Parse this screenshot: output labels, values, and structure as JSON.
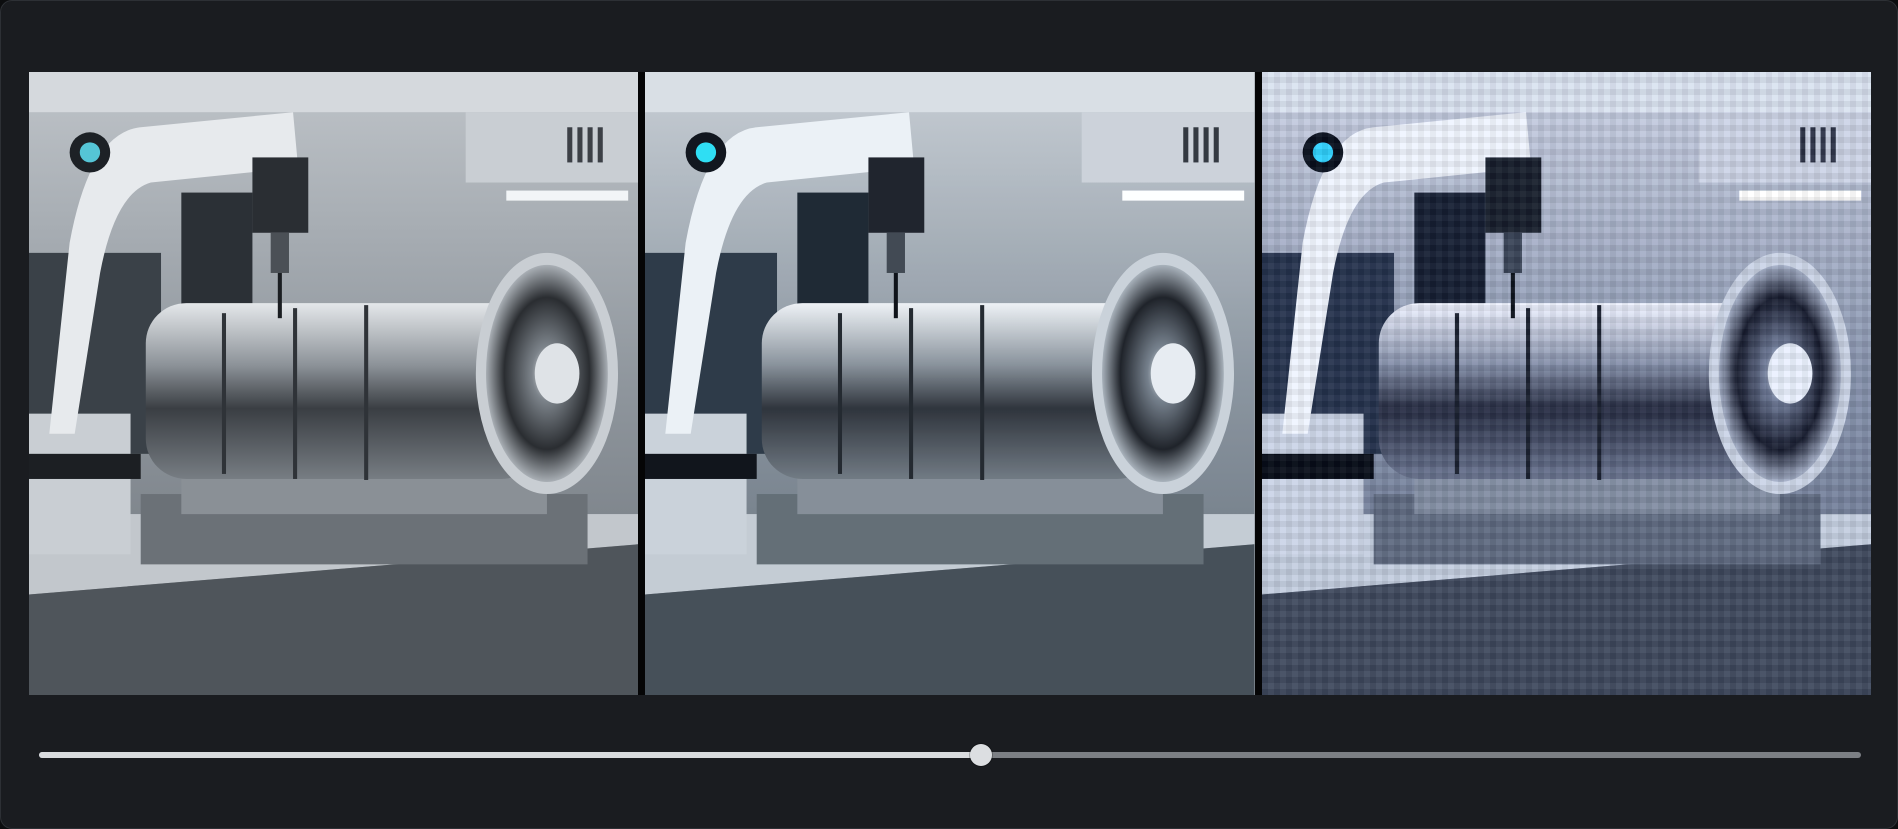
{
  "viewer": {
    "panels": [
      {
        "id": "original",
        "subject": "robotic-arm-jet-engine-render"
      },
      {
        "id": "compressed-medium",
        "subject": "robotic-arm-jet-engine-render"
      },
      {
        "id": "compressed-heavy",
        "subject": "robotic-arm-jet-engine-render"
      }
    ]
  },
  "slider": {
    "value": 0.517,
    "min": 0,
    "max": 1
  },
  "colors": {
    "frame_bg": "#1a1c20",
    "track": "#7c7f84",
    "fill": "#d9dbde",
    "thumb": "#dcdee1"
  }
}
